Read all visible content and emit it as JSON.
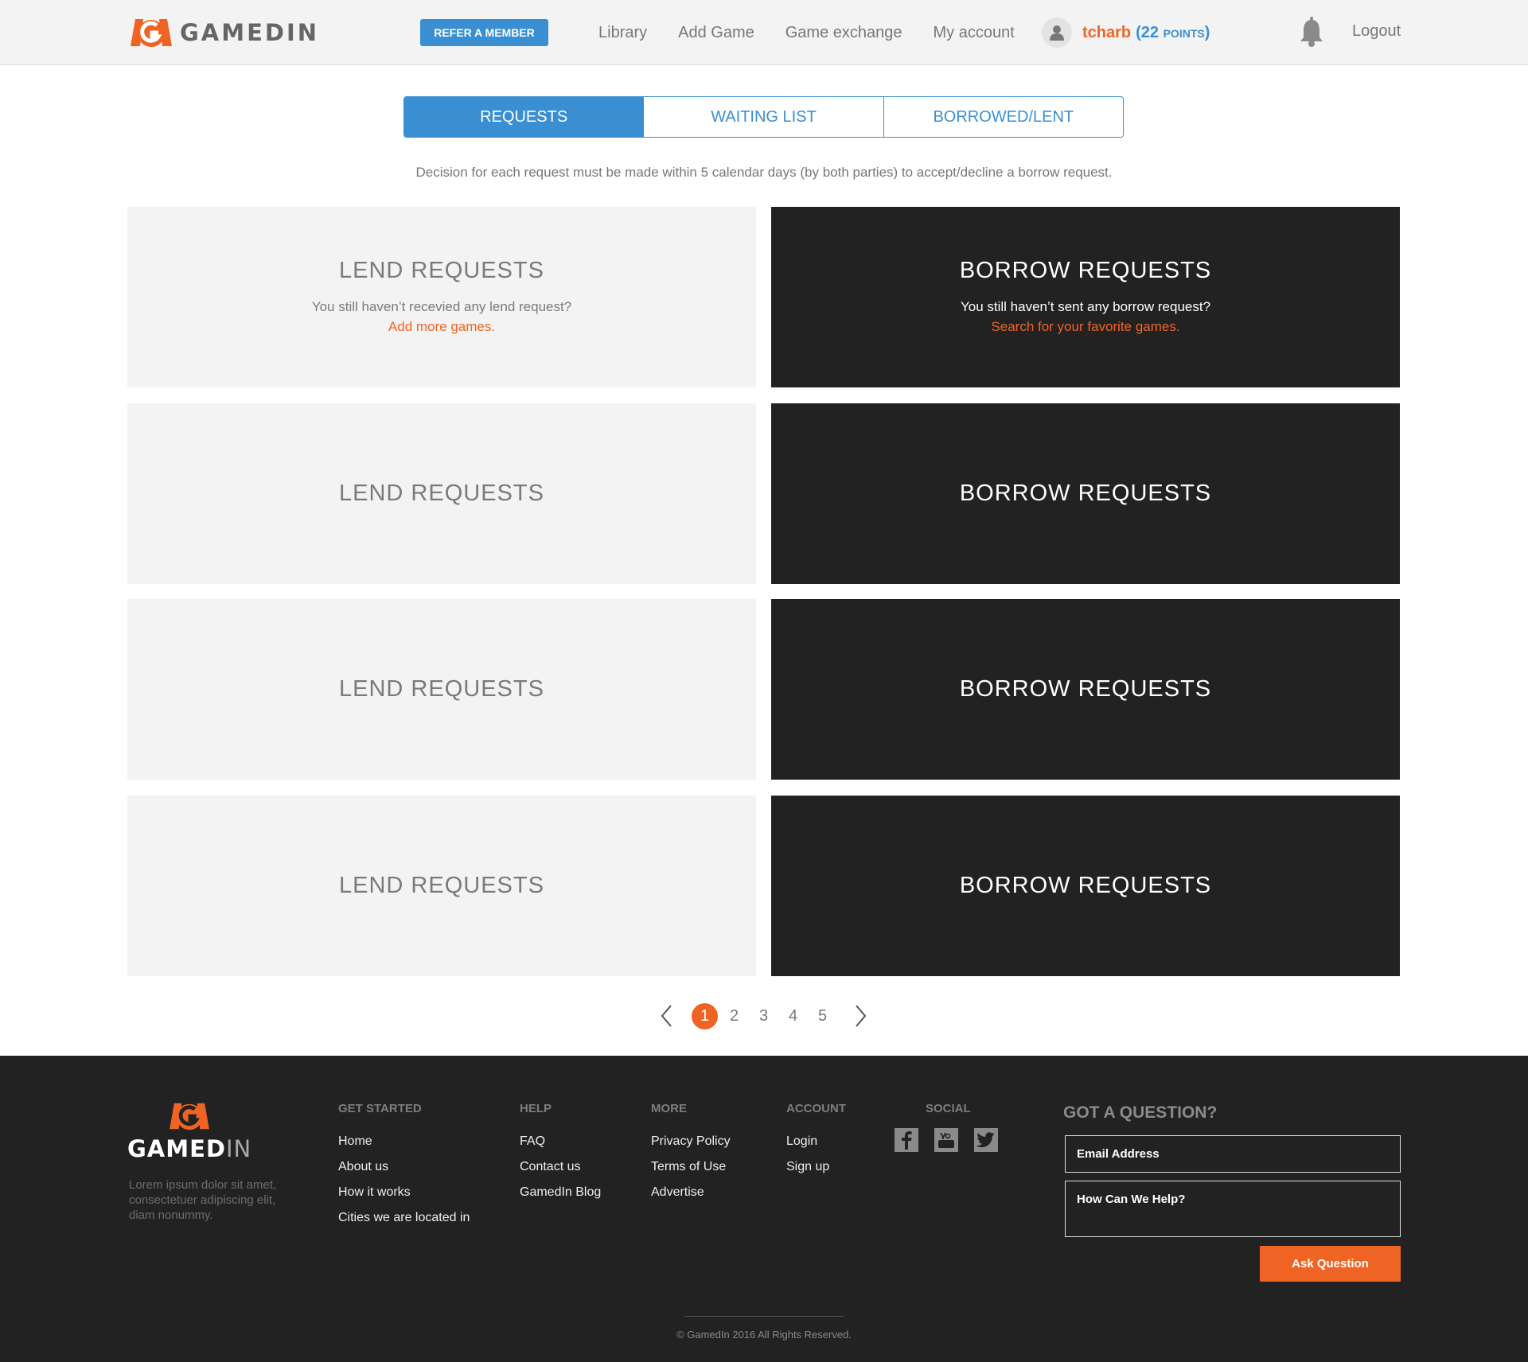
{
  "header": {
    "logo_text": "GAMEDIN",
    "refer_label": "REFER A MEMBER",
    "nav": [
      "Library",
      "Add Game",
      "Game exchange",
      "My account"
    ],
    "username": "tcharb",
    "points_open": "(22",
    "points_word": "POINTS",
    "points_close": ")",
    "logout_label": "Logout",
    "icons": {
      "avatar": "user-icon",
      "bell": "bell-icon"
    }
  },
  "tabs": [
    {
      "label": "REQUESTS",
      "active": true
    },
    {
      "label": "WAITING LIST",
      "active": false
    },
    {
      "label": "BORROWED/LENT",
      "active": false
    }
  ],
  "notice": "Decision for each request must be made within 5 calendar days (by both parties) to accept/decline a borrow request.",
  "cards": {
    "lend_title": "LEND REQUESTS",
    "borrow_title": "BORROW REQUESTS",
    "lend_empty_text": "You still haven’t recevied any lend request?",
    "lend_empty_link": "Add more games.",
    "borrow_empty_text": "You still haven’t sent any borrow request?",
    "borrow_empty_link": "Search for your favorite games."
  },
  "pagination": {
    "pages": [
      "1",
      "2",
      "3",
      "4",
      "5"
    ],
    "current": "1"
  },
  "footer": {
    "logo_text_main": "GAMED",
    "logo_text_in": "IN",
    "description": "Lorem ipsum dolor sit amet, consectetuer adipiscing elit, diam nonummy.",
    "columns": [
      {
        "title": "GET STARTED",
        "links": [
          "Home",
          "About us",
          "How it works",
          "Cities we are located in"
        ]
      },
      {
        "title": "HELP",
        "links": [
          "FAQ",
          "Contact us",
          "GamedIn Blog"
        ]
      },
      {
        "title": "MORE",
        "links": [
          "Privacy Policy",
          "Terms of Use",
          "Advertise"
        ]
      },
      {
        "title": "ACCOUNT",
        "links": [
          "Login",
          "Sign up"
        ]
      }
    ],
    "social_title": "SOCIAL",
    "social_icons": [
      "facebook-icon",
      "youtube-icon",
      "twitter-icon"
    ],
    "question_title": "GOT A QUESTION?",
    "email_placeholder": "Email Address",
    "help_placeholder": "How Can We Help?",
    "ask_label": "Ask Question",
    "copyright": "© GamedIn 2016 All Rights Reserved."
  },
  "colors": {
    "brand_orange": "#ef6425",
    "accent_blue": "#3a8fd2",
    "dark": "#222222",
    "light_panel": "#f3f3f3"
  }
}
